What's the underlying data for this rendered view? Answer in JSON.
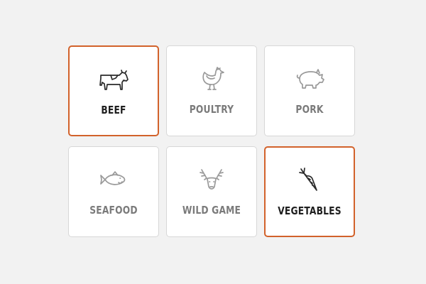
{
  "categories": [
    {
      "label": "BEEF",
      "icon": "cow-icon",
      "selected": true
    },
    {
      "label": "POULTRY",
      "icon": "chicken-icon",
      "selected": false
    },
    {
      "label": "PORK",
      "icon": "pig-icon",
      "selected": false
    },
    {
      "label": "SEAFOOD",
      "icon": "fish-icon",
      "selected": false
    },
    {
      "label": "WILD GAME",
      "icon": "deer-icon",
      "selected": false
    },
    {
      "label": "VEGETABLES",
      "icon": "carrot-icon",
      "selected": true
    }
  ],
  "colors": {
    "selected_border": "#d2622b",
    "tile_border": "#d7d7d7",
    "background": "#f2f2f2",
    "selected_text": "#1f1f1f",
    "unselected_text": "#7b7b7b"
  }
}
